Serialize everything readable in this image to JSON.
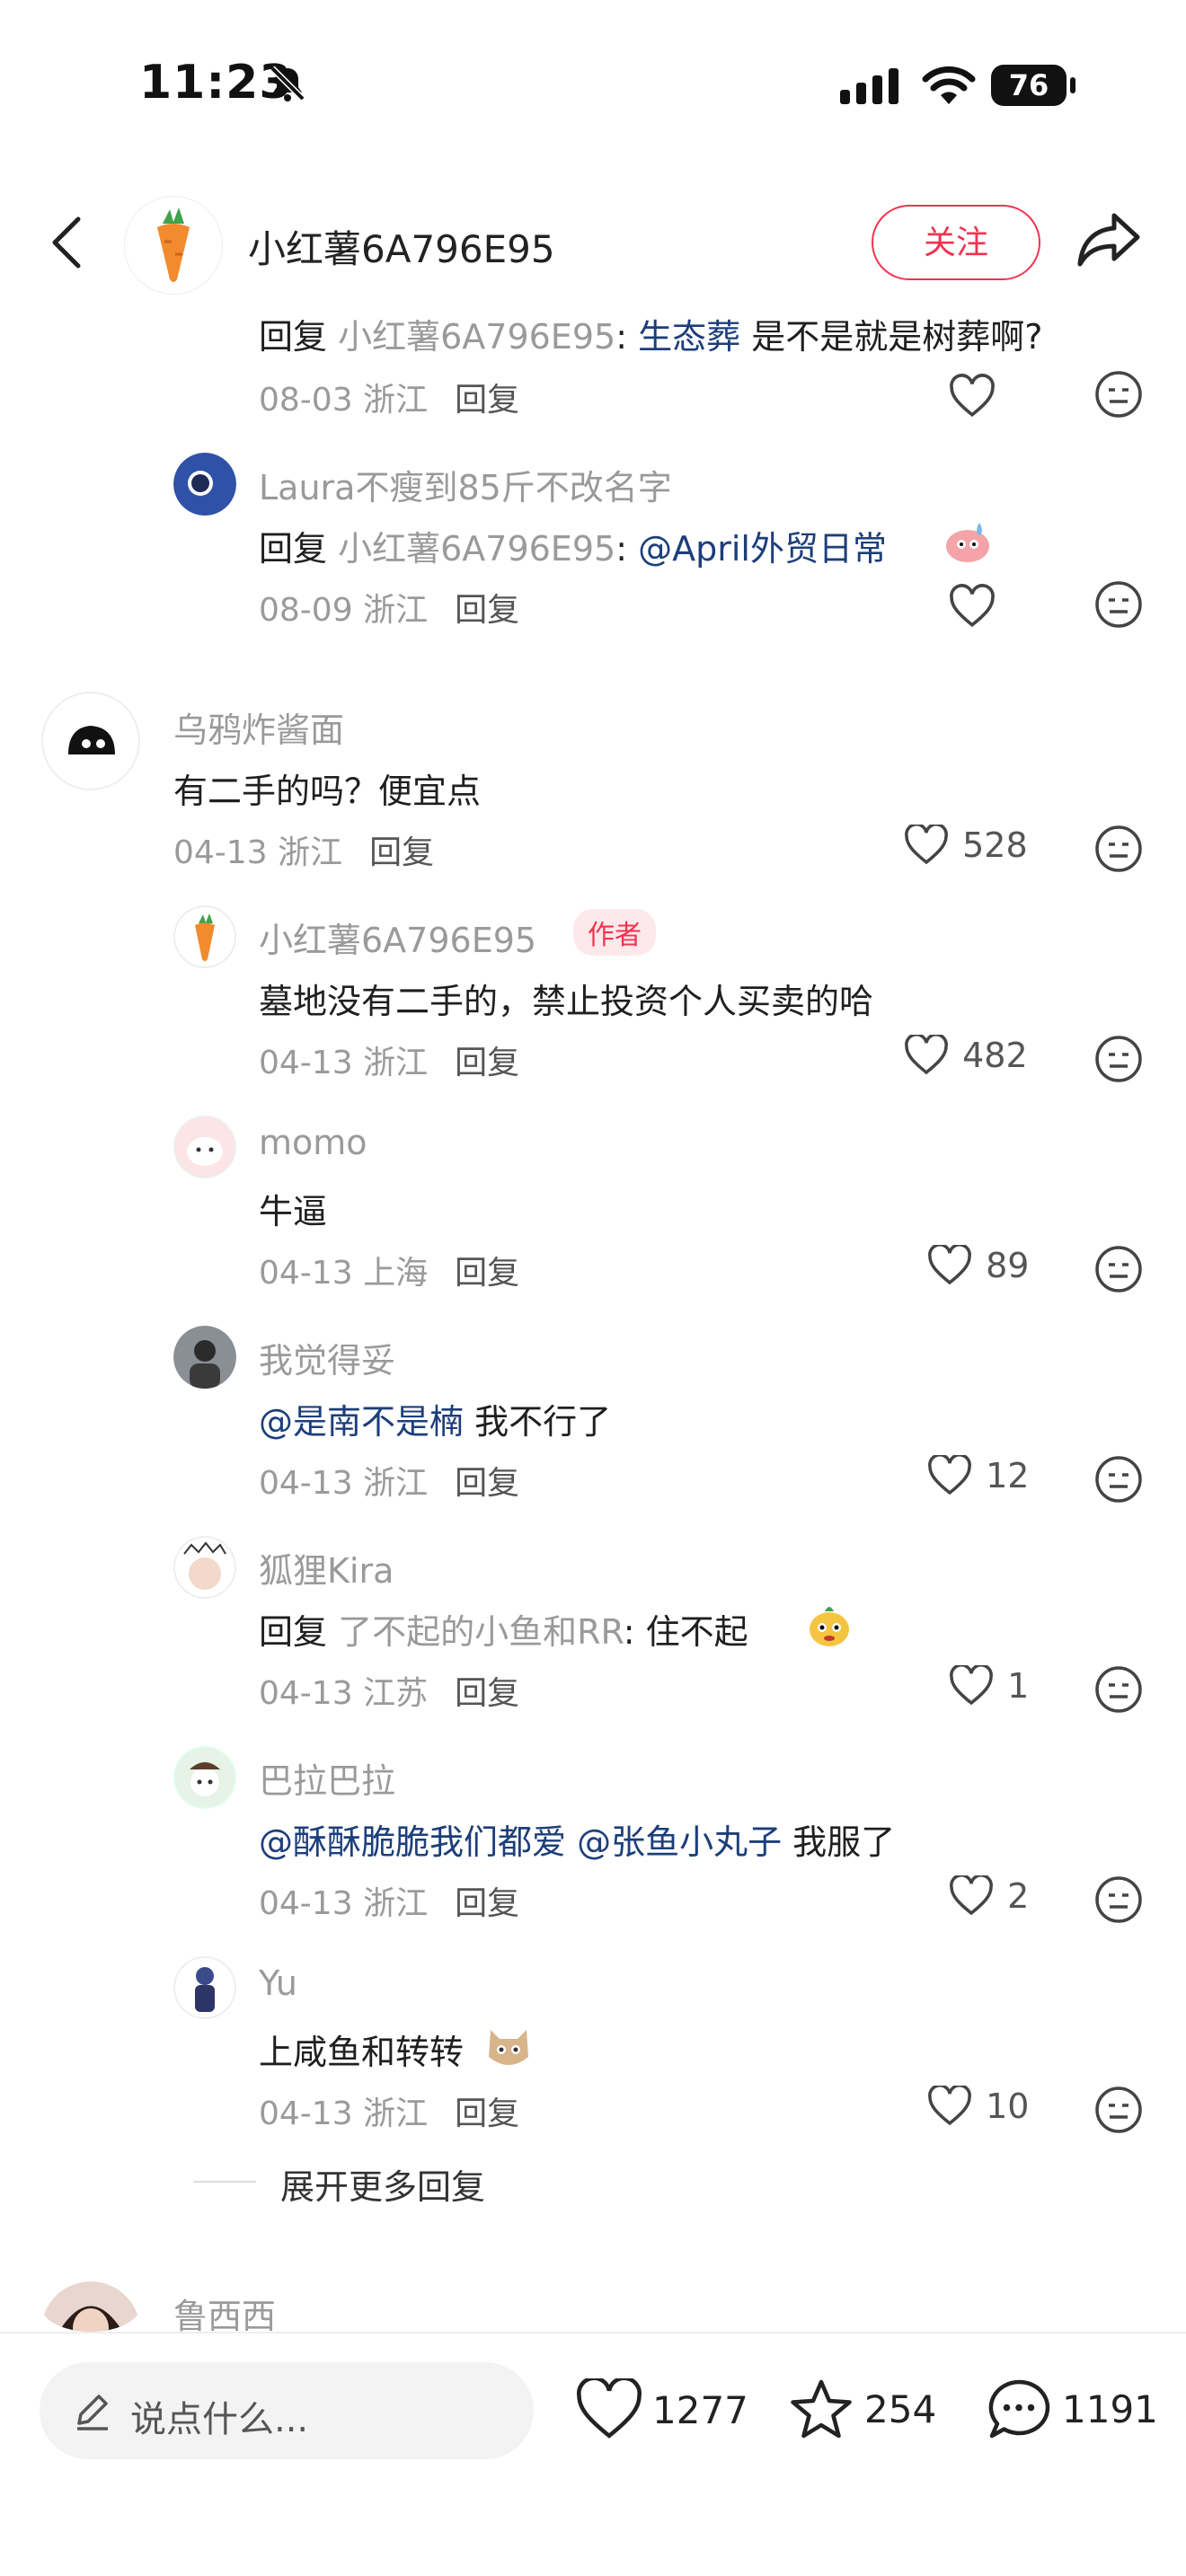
{
  "status_bar": {
    "time": "11:23",
    "battery": "76"
  },
  "header": {
    "username": "小红薯6A796E95",
    "follow_label": "关注"
  },
  "comments": [
    {
      "reply_prefix": "回复",
      "reply_to": "小红薯6A796E95",
      "colon": ":",
      "text_mention": "生态葬",
      "text_tail": " 是不是就是树葬啊?",
      "date": "08-03",
      "location": "浙江",
      "reply_label": "回复"
    },
    {
      "name": "Laura不瘦到85斤不改名字",
      "reply_prefix": "回复",
      "reply_to": "小红薯6A796E95",
      "colon": ":",
      "text_mention": "@April外贸日常",
      "date": "08-09",
      "location": "浙江",
      "reply_label": "回复"
    },
    {
      "name": "乌鸦炸酱面",
      "text": "有二手的吗？便宜点",
      "date": "04-13",
      "location": "浙江",
      "reply_label": "回复",
      "likes": "528"
    },
    {
      "name": "小红薯6A796E95",
      "badge": "作者",
      "text": "墓地没有二手的，禁止投资个人买卖的哈",
      "date": "04-13",
      "location": "浙江",
      "reply_label": "回复",
      "likes": "482"
    },
    {
      "name": "momo",
      "text": "牛逼",
      "date": "04-13",
      "location": "上海",
      "reply_label": "回复",
      "likes": "89"
    },
    {
      "name": "我觉得妥",
      "text_mention": "@是南不是楠",
      "text_tail": " 我不行了",
      "date": "04-13",
      "location": "浙江",
      "reply_label": "回复",
      "likes": "12"
    },
    {
      "name": "狐狸Kira",
      "reply_prefix": "回复",
      "reply_to": "了不起的小鱼和RR",
      "colon": ":",
      "text_tail": " 住不起",
      "date": "04-13",
      "location": "江苏",
      "reply_label": "回复",
      "likes": "1"
    },
    {
      "name": "巴拉巴拉",
      "text_mention": "@酥酥脆脆我们都爱 @张鱼小丸子",
      "text_tail": " 我服了",
      "date": "04-13",
      "location": "浙江",
      "reply_label": "回复",
      "likes": "2"
    },
    {
      "name": "Yu",
      "text": "上咸鱼和转转",
      "date": "04-13",
      "location": "浙江",
      "reply_label": "回复",
      "likes": "10"
    }
  ],
  "expand_more": "展开更多回复",
  "next_comment": {
    "name": "鲁西西"
  },
  "bottom_bar": {
    "input_placeholder": "说点什么...",
    "likes": "1277",
    "favorites": "254",
    "comments": "1191"
  },
  "colors": {
    "accent": "#f0334f",
    "mention": "#1c3e7a",
    "muted": "#9a9a9a"
  },
  "icons": [
    "bell-slash-icon",
    "signal-icon",
    "wifi-icon",
    "battery-icon",
    "back-icon",
    "share-icon",
    "heart-icon",
    "neutral-face-icon",
    "pencil-icon",
    "star-icon",
    "comment-icon"
  ]
}
